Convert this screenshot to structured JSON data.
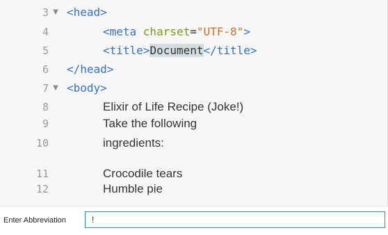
{
  "editor": {
    "lines": [
      {
        "num": "3",
        "fold": "▼",
        "tag1": "<head>"
      },
      {
        "num": "4",
        "tag_open": "<meta ",
        "attr": "charset",
        "eq": "=",
        "str": "\"UTF-8\"",
        "tag_close": ">"
      },
      {
        "num": "5",
        "tag_open": "<title>",
        "highlight": "Document",
        "tag_close": "</title>"
      },
      {
        "num": "6",
        "tag1": "</head>"
      },
      {
        "num": "7",
        "fold": "▼",
        "tag1": "<body>"
      },
      {
        "num": "8",
        "text": "Elixir of Life Recipe (Joke!)"
      },
      {
        "num": "9",
        "text": "Take the following"
      },
      {
        "num": "10",
        "text": "ingredients:"
      },
      {
        "num": "11",
        "text": "Crocodile tears"
      },
      {
        "num": "12",
        "text": "Humble pie"
      }
    ]
  },
  "abbreviation": {
    "label": "Enter Abbreviation",
    "value": "!"
  },
  "colors": {
    "tag": "#3670c8",
    "attribute": "#7a9a18",
    "string": "#d1712b",
    "selection": "#d4dde2",
    "input_focus_border": "#2f86d8"
  },
  "icons": {
    "fold": "fold-arrow-icon"
  }
}
